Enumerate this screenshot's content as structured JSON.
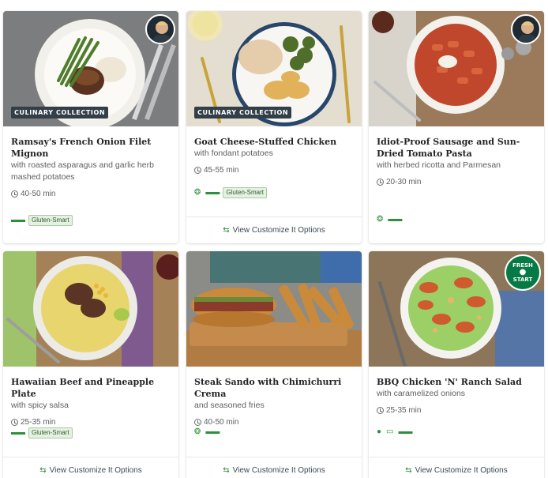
{
  "colors": {
    "accent": "#067a46",
    "badge_bg": "#333f48",
    "tag_green": "#2d8f3c"
  },
  "recipes": [
    {
      "title": "Ramsay's French Onion Filet Mignon",
      "subtitle": "with roasted asparagus and garlic herb mashed potatoes",
      "time": "40-50 min",
      "badge": "CULINARY COLLECTION",
      "chef_icon": "chef-avatar-icon",
      "tags": [
        "muscle-icon"
      ],
      "pill": "Gluten-Smart",
      "footer": ""
    },
    {
      "title": "Goat Cheese-Stuffed Chicken",
      "subtitle": "with fondant potatoes",
      "time": "45-55 min",
      "badge": "CULINARY COLLECTION",
      "tags": [
        "ear-icon",
        "muscle-icon"
      ],
      "pill": "Gluten-Smart",
      "footer": "View Customize It Options"
    },
    {
      "title": "Idiot-Proof Sausage and Sun-Dried Tomato Pasta",
      "subtitle": "with herbed ricotta and Parmesan",
      "time": "20-30 min",
      "chef_icon": "chef-avatar-icon",
      "tags": [
        "ear-icon",
        "muscle-icon"
      ],
      "pill": "",
      "footer": ""
    },
    {
      "title": "Hawaiian Beef and Pineapple Plate",
      "subtitle": "with spicy salsa",
      "time": "25-35 min",
      "tags": [
        "muscle-icon"
      ],
      "pill": "Gluten-Smart",
      "footer": "View Customize It Options"
    },
    {
      "title": "Steak Sando with Chimichurri Crema",
      "subtitle": "and seasoned fries",
      "time": "40-50 min",
      "tags": [
        "ear-icon",
        "muscle-icon"
      ],
      "pill": "",
      "footer": "View Customize It Options"
    },
    {
      "title": "BBQ Chicken 'N' Ranch Salad",
      "subtitle": "with caramelized onions",
      "time": "25-35 min",
      "fresh_badge": [
        "FRESH",
        "START"
      ],
      "tags": [
        "apple-icon",
        "scale-icon",
        "muscle-icon"
      ],
      "pill": "",
      "footer": "View Customize It Options"
    }
  ]
}
